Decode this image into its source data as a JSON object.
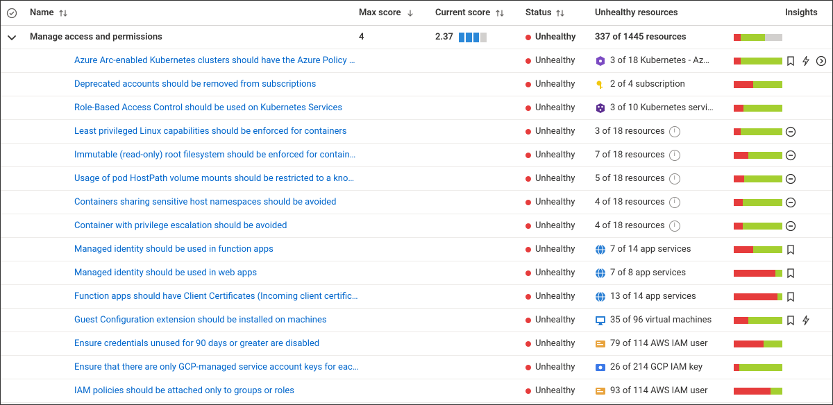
{
  "columns": {
    "name": "Name",
    "max": "Max score",
    "curr": "Current score",
    "status": "Status",
    "unhealthy": "Unhealthy resources",
    "insights": "Insights"
  },
  "group": {
    "title": "Manage access and permissions",
    "max": "4",
    "curr": "2.37",
    "status": "Unhealthy",
    "unhealthy": "337 of 1445 resources",
    "score_on": 3,
    "bar": {
      "r": 14,
      "g": 50,
      "gr": 36
    }
  },
  "rows": [
    {
      "name": "Azure Arc-enabled Kubernetes clusters should have the Azure Policy extension …",
      "status": "Unhealthy",
      "icon": "kube-purple",
      "res": "3 of 18 Kubernetes - Az…",
      "bar": {
        "r": 14,
        "g": 86,
        "gr": 0
      },
      "ins": [
        "bookmark",
        "flash",
        "open"
      ]
    },
    {
      "name": "Deprecated accounts should be removed from subscriptions",
      "status": "Unhealthy",
      "icon": "key",
      "res": "2 of 4 subscription",
      "bar": {
        "r": 40,
        "g": 60,
        "gr": 0
      },
      "ins": []
    },
    {
      "name": "Role-Based Access Control should be used on Kubernetes Services",
      "status": "Unhealthy",
      "icon": "kube-cluster",
      "res": "3 of 10 Kubernetes servi…",
      "bar": {
        "r": 20,
        "g": 80,
        "gr": 0
      },
      "ins": []
    },
    {
      "name": "Least privileged Linux capabilities should be enforced for containers",
      "status": "Unhealthy",
      "icon": "",
      "res": "3 of 18 resources",
      "info": true,
      "bar": {
        "r": 14,
        "g": 86,
        "gr": 0
      },
      "ins": [
        "minus"
      ]
    },
    {
      "name": "Immutable (read-only) root filesystem should be enforced for containers",
      "status": "Unhealthy",
      "icon": "",
      "res": "7 of 18 resources",
      "info": true,
      "bar": {
        "r": 30,
        "g": 70,
        "gr": 0
      },
      "ins": [
        "minus"
      ]
    },
    {
      "name": "Usage of pod HostPath volume mounts should be restricted to a known list to …",
      "status": "Unhealthy",
      "icon": "",
      "res": "5 of 18 resources",
      "info": true,
      "bar": {
        "r": 22,
        "g": 78,
        "gr": 0
      },
      "ins": [
        "minus"
      ]
    },
    {
      "name": "Containers sharing sensitive host namespaces should be avoided",
      "status": "Unhealthy",
      "icon": "",
      "res": "4 of 18 resources",
      "info": true,
      "bar": {
        "r": 18,
        "g": 82,
        "gr": 0
      },
      "ins": [
        "minus"
      ]
    },
    {
      "name": "Container with privilege escalation should be avoided",
      "status": "Unhealthy",
      "icon": "",
      "res": "4 of 18 resources",
      "info": true,
      "bar": {
        "r": 18,
        "g": 82,
        "gr": 0
      },
      "ins": [
        "minus"
      ]
    },
    {
      "name": "Managed identity should be used in function apps",
      "status": "Unhealthy",
      "icon": "globe",
      "res": "7 of 14 app services",
      "bar": {
        "r": 40,
        "g": 60,
        "gr": 0
      },
      "ins": [
        "bookmark"
      ]
    },
    {
      "name": "Managed identity should be used in web apps",
      "status": "Unhealthy",
      "icon": "globe",
      "res": "7 of 8 app services",
      "bar": {
        "r": 85,
        "g": 15,
        "gr": 0
      },
      "ins": [
        "bookmark"
      ]
    },
    {
      "name": "Function apps should have Client Certificates (Incoming client certificates) enab…",
      "status": "Unhealthy",
      "icon": "globe",
      "res": "13 of 14 app services",
      "bar": {
        "r": 90,
        "g": 10,
        "gr": 0
      },
      "ins": [
        "bookmark"
      ]
    },
    {
      "name": "Guest Configuration extension should be installed on machines",
      "status": "Unhealthy",
      "icon": "vm",
      "res": "35 of 96 virtual machines",
      "bar": {
        "r": 30,
        "g": 70,
        "gr": 0
      },
      "ins": [
        "bookmark",
        "flash"
      ]
    },
    {
      "name": "Ensure credentials unused for 90 days or greater are disabled",
      "status": "Unhealthy",
      "icon": "aws",
      "res": "79 of 114 AWS IAM user",
      "bar": {
        "r": 62,
        "g": 38,
        "gr": 0
      },
      "ins": []
    },
    {
      "name": "Ensure that there are only GCP-managed service account keys for each service …",
      "status": "Unhealthy",
      "icon": "gcp",
      "res": "26 of 214 GCP IAM key",
      "bar": {
        "r": 12,
        "g": 88,
        "gr": 0
      },
      "ins": []
    },
    {
      "name": "IAM policies should be attached only to groups or roles",
      "status": "Unhealthy",
      "icon": "aws",
      "res": "93 of 114 AWS IAM user",
      "bar": {
        "r": 76,
        "g": 24,
        "gr": 0
      },
      "ins": []
    }
  ]
}
